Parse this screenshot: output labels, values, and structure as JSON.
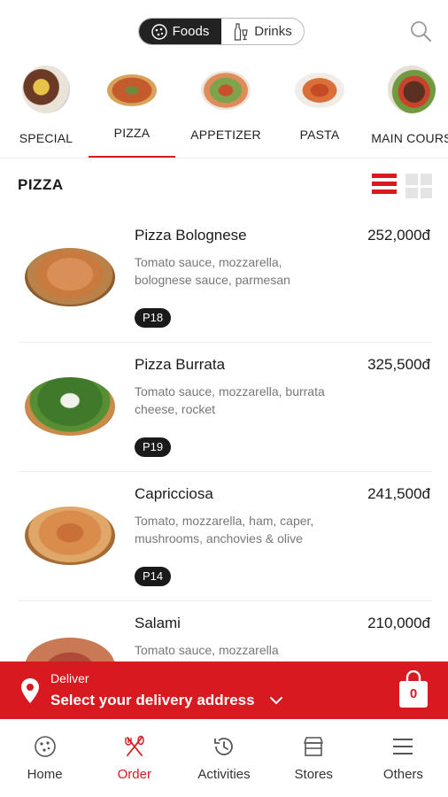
{
  "header": {
    "tabs": [
      {
        "label": "Foods",
        "active": true
      },
      {
        "label": "Drinks",
        "active": false
      }
    ]
  },
  "categories": [
    {
      "label": "SPECIAL"
    },
    {
      "label": "PIZZA",
      "active": true
    },
    {
      "label": "APPETIZER"
    },
    {
      "label": "PASTA"
    },
    {
      "label": "MAIN COURS"
    }
  ],
  "section": {
    "title": "PIZZA"
  },
  "products": [
    {
      "name": "Pizza Bolognese",
      "price": "252,000đ",
      "desc": "Tomato sauce, mozzarella, bolognese sauce, parmesan",
      "code": "P18"
    },
    {
      "name": "Pizza Burrata",
      "price": "325,500đ",
      "desc": "Tomato sauce, mozzarella, burrata cheese, rocket",
      "code": "P19"
    },
    {
      "name": "Capricciosa",
      "price": "241,500đ",
      "desc": "Tomato, mozzarella, ham, caper, mushrooms, anchovies & olive",
      "code": "P14"
    },
    {
      "name": "Salami",
      "price": "210,000đ",
      "desc": "Tomato sauce, mozzarella",
      "code": ""
    }
  ],
  "delivery": {
    "label": "Deliver",
    "address": "Select your delivery address",
    "cart_count": "0"
  },
  "nav": [
    {
      "label": "Home"
    },
    {
      "label": "Order",
      "active": true
    },
    {
      "label": "Activities"
    },
    {
      "label": "Stores"
    },
    {
      "label": "Others"
    }
  ],
  "colors": {
    "accent": "#d71920",
    "dark": "#1a1a1a"
  }
}
